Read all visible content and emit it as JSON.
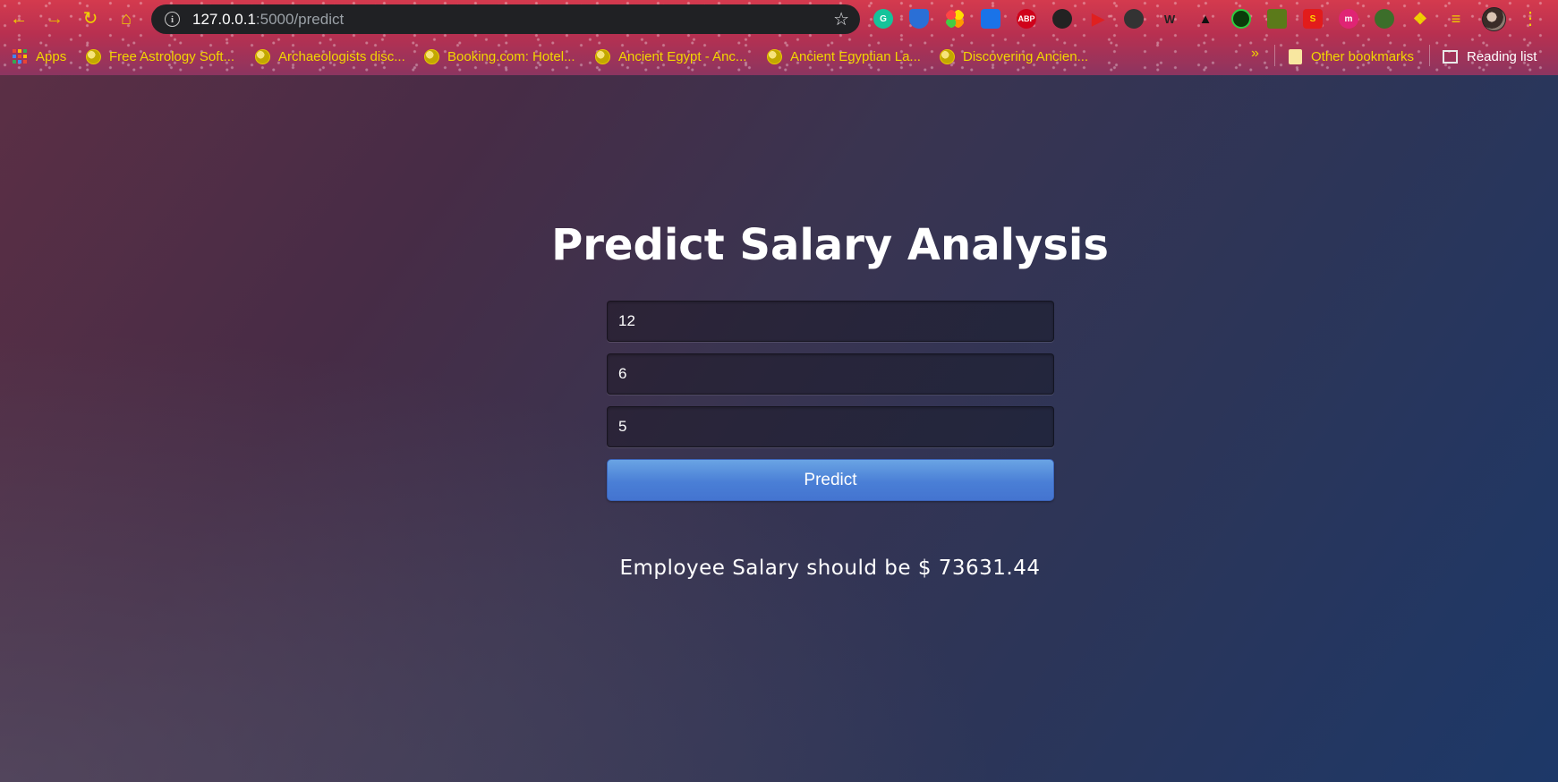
{
  "browser": {
    "address_host": "127.0.0.1",
    "address_path": ":5000/predict",
    "nav_icons": [
      "back-arrow",
      "forward-arrow",
      "reload",
      "home"
    ],
    "extensions": [
      "grammarly",
      "shield",
      "colorful-flower",
      "translate",
      "adblock-plus",
      "helmet",
      "video-play",
      "graduation-cap",
      "wonder-woman-logo",
      "batman-logo",
      "green-lantern",
      "aquaman",
      "superman-logo",
      "m-logo",
      "leaf",
      "puzzle",
      "reading-list-queue"
    ],
    "adblock_label": "ABP",
    "bookmarks": [
      {
        "label": "Apps",
        "icon": "apps-grid-icon"
      },
      {
        "label": "Free Astrology Soft...",
        "icon": "globe-icon"
      },
      {
        "label": "Archaeologists disc...",
        "icon": "globe-icon"
      },
      {
        "label": "Booking.com: Hotel...",
        "icon": "globe-icon"
      },
      {
        "label": "Ancient Egypt - Anc...",
        "icon": "globe-icon"
      },
      {
        "label": "Ancient Egyptian La...",
        "icon": "globe-icon"
      },
      {
        "label": "Discovering Ancien...",
        "icon": "globe-icon"
      }
    ],
    "overflow": "»",
    "other_bookmarks": "Other bookmarks",
    "reading_list": "Reading list"
  },
  "page": {
    "title": "Predict Salary Analysis",
    "inputs": [
      {
        "value": "12"
      },
      {
        "value": "6"
      },
      {
        "value": "5"
      }
    ],
    "predict_button": "Predict",
    "result_text": "Employee Salary should be $ 73631.44"
  },
  "colors": {
    "accent": "#4a7fd6",
    "bookmark_text": "#f2d600",
    "omnibox_bg": "#202124"
  }
}
